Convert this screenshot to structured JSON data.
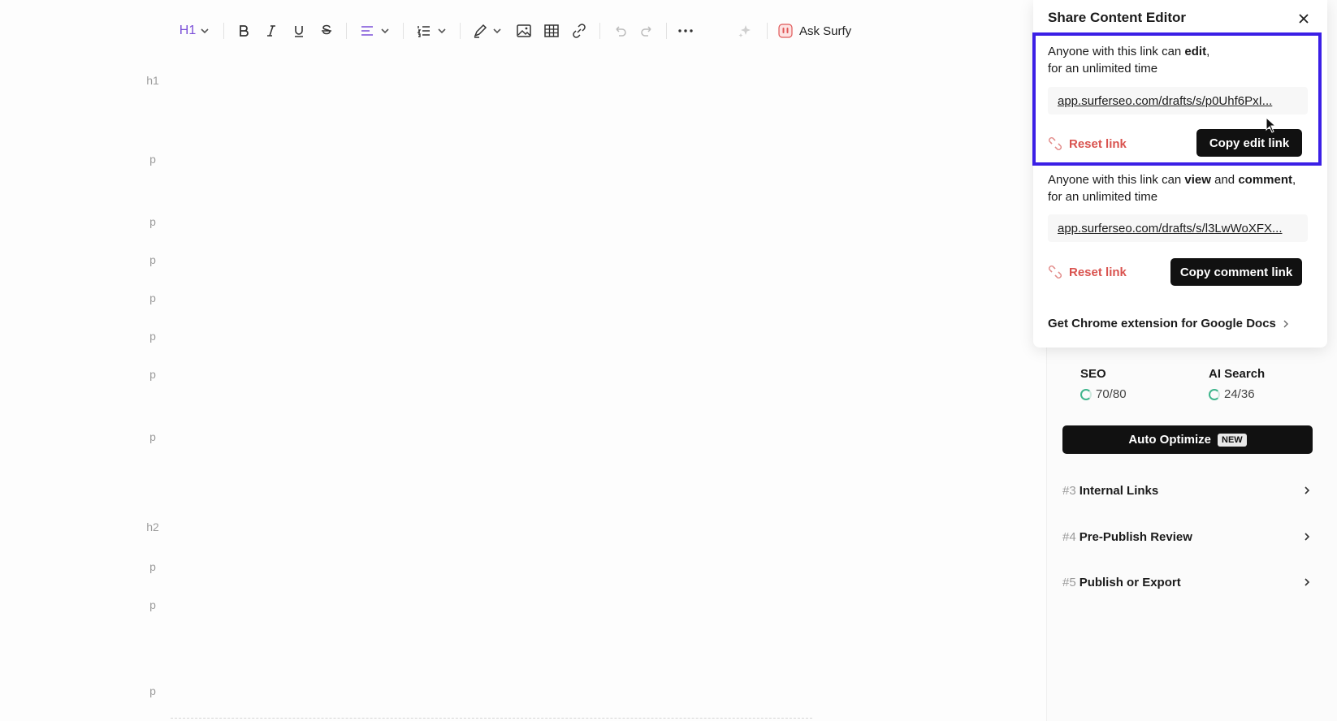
{
  "toolbar": {
    "heading_label": "H1",
    "ask_surfy_label": "Ask Surfy"
  },
  "gutter": [
    "h1",
    "p",
    "p",
    "p",
    "p",
    "p",
    "p",
    "p",
    "h2",
    "p",
    "p",
    "p"
  ],
  "share": {
    "title": "Share Content Editor",
    "edit": {
      "desc_pre": "Anyone with this link can ",
      "desc_bold": "edit",
      "desc_post": ",",
      "desc_line2": "for an unlimited time",
      "url": "app.surferseo.com/drafts/s/p0Uhf6PxI...",
      "reset_label": "Reset link",
      "copy_label": "Copy edit link"
    },
    "comment": {
      "desc_pre": "Anyone with this link can ",
      "desc_bold1": "view",
      "desc_mid": " and ",
      "desc_bold2": "comment",
      "desc_post": ",",
      "desc_line2": "for an unlimited time",
      "url": "app.surferseo.com/drafts/s/l3LwWoXFX...",
      "reset_label": "Reset link",
      "copy_label": "Copy comment link"
    },
    "chrome_link": "Get Chrome extension for Google Docs"
  },
  "sidebar": {
    "seo": {
      "title": "SEO",
      "value": "70/80"
    },
    "ai_search": {
      "title": "AI Search",
      "value": "24/36"
    },
    "auto_optimize": {
      "label": "Auto Optimize",
      "badge": "NEW"
    },
    "steps": [
      {
        "num": "#3",
        "label": "Internal Links"
      },
      {
        "num": "#4",
        "label": "Pre-Publish Review"
      },
      {
        "num": "#5",
        "label": "Publish or Export"
      }
    ]
  },
  "colors": {
    "highlight": "#3b1fe6",
    "reset": "#d9534f",
    "button": "#111111",
    "score_ring": "#3fb58c"
  }
}
